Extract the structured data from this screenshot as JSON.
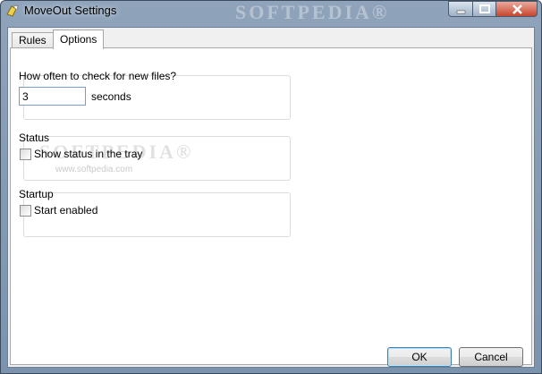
{
  "window": {
    "title": "MoveOut Settings",
    "watermark": "SOFTPEDIA®"
  },
  "tabs": [
    {
      "label": "Rules"
    },
    {
      "label": "Options"
    }
  ],
  "options": {
    "check_interval": {
      "group_label": "How often to check for new files?",
      "value": "3",
      "unit": "seconds"
    },
    "status": {
      "group_label": "Status",
      "checkbox_label": "Show status in the tray",
      "checked": false
    },
    "startup": {
      "group_label": "Startup",
      "checkbox_label": "Start enabled",
      "checked": false
    },
    "watermark": "SOFTPEDIA®",
    "watermark_url": "www.softpedia.com"
  },
  "buttons": {
    "ok": "OK",
    "cancel": "Cancel"
  },
  "colors": {
    "titlebar": "#8fa3ba",
    "close_button": "#c8452d",
    "panel": "#f0f0f0"
  }
}
